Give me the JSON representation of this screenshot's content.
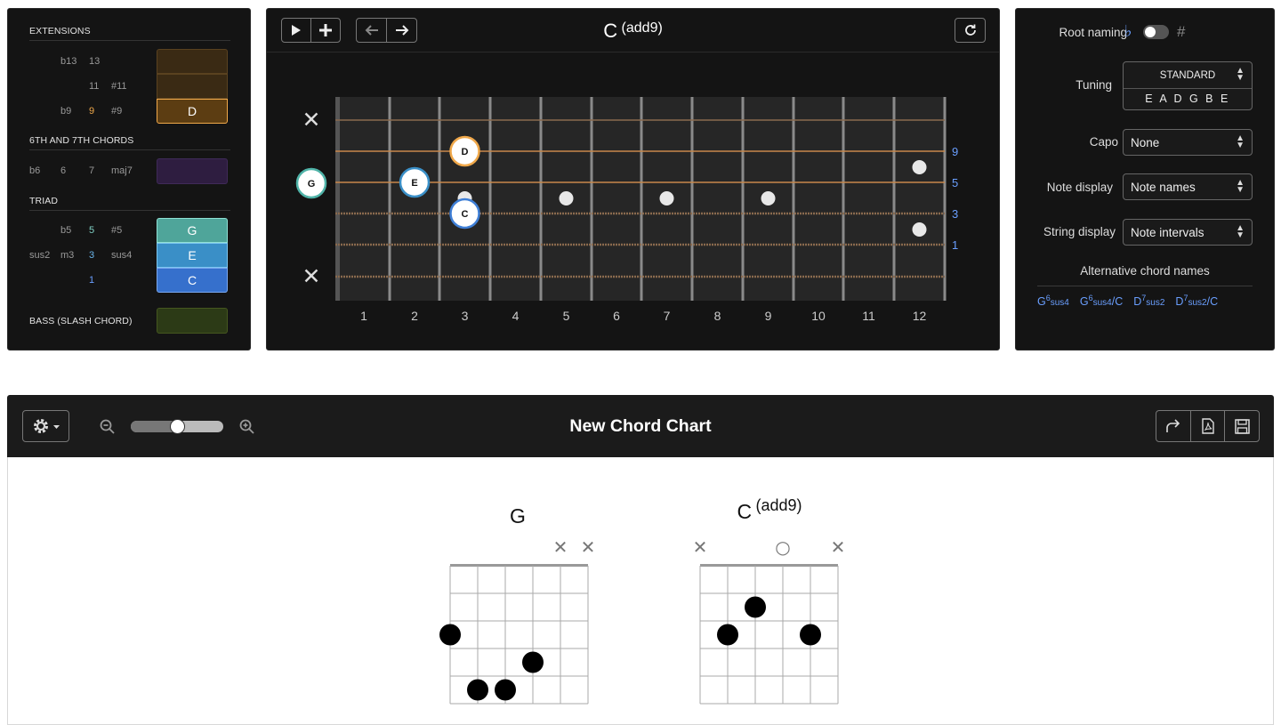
{
  "chord_builder": {
    "extensions": {
      "title": "EXTENSIONS",
      "rows": [
        [
          "b13",
          "13"
        ],
        [
          "11",
          "#11"
        ],
        [
          "b9",
          "9",
          "#9"
        ]
      ],
      "selected": [
        "",
        "",
        "D"
      ]
    },
    "sixth_seventh": {
      "title": "6TH AND 7TH CHORDS",
      "intervals": [
        "b6",
        "6",
        "7",
        "maj7"
      ],
      "selected": ""
    },
    "triad": {
      "title": "TRIAD",
      "rows": [
        [
          "b5",
          "5",
          "#5"
        ],
        [
          "sus2",
          "m3",
          "3",
          "sus4"
        ],
        [
          "1"
        ]
      ],
      "selected": [
        "G",
        "E",
        "C"
      ]
    },
    "bass": {
      "title": "BASS (SLASH CHORD)",
      "selected": ""
    }
  },
  "fretboard": {
    "chord_root": "C",
    "chord_suffix": "(add9)",
    "string_markers": [
      "✕",
      "G",
      "✕"
    ],
    "notes": [
      {
        "label": "D",
        "string": 3,
        "fret": 3,
        "kind": "ext"
      },
      {
        "label": "E",
        "string": 4,
        "fret": 2,
        "kind": "third"
      },
      {
        "label": "C",
        "string": 5,
        "fret": 3,
        "kind": "root"
      }
    ],
    "open_note": {
      "label": "G",
      "string": 2
    },
    "muted_strings": [
      1,
      6
    ],
    "interval_labels": [
      "9",
      "5",
      "3",
      "1"
    ],
    "fret_numbers": [
      "1",
      "2",
      "3",
      "4",
      "5",
      "6",
      "7",
      "8",
      "9",
      "10",
      "11",
      "12"
    ],
    "inlays": [
      3,
      5,
      7,
      9,
      12
    ]
  },
  "settings": {
    "root_naming_label": "Root naming",
    "flat_symbol": "♭",
    "sharp_symbol": "#",
    "tuning_label": "Tuning",
    "tuning_name": "STANDARD",
    "tuning_notes": "E A D G B E",
    "capo_label": "Capo",
    "capo_value": "None",
    "note_display_label": "Note display",
    "note_display_value": "Note names",
    "string_display_label": "String display",
    "string_display_value": "Note intervals",
    "alt_names_label": "Alternative chord names",
    "alt_names": [
      {
        "root": "G",
        "sup": "6",
        "sub": "sus4",
        "bass": ""
      },
      {
        "root": "G",
        "sup": "6",
        "sub": "sus4",
        "bass": "/C"
      },
      {
        "root": "D",
        "sup": "7",
        "sub": "sus2",
        "bass": ""
      },
      {
        "root": "D",
        "sup": "7",
        "sub": "sus2",
        "bass": "/C"
      }
    ]
  },
  "chart": {
    "title": "New Chord Chart",
    "zoom_level": 0.5,
    "diagrams": [
      {
        "name": "G",
        "suffix": "",
        "top_markers": [
          "",
          "",
          "",
          "",
          "✕",
          "✕"
        ],
        "dots": [
          {
            "s": 0,
            "f": 3
          },
          {
            "s": 1,
            "f": 5
          },
          {
            "s": 2,
            "f": 5
          },
          {
            "s": 3,
            "f": 4
          }
        ]
      },
      {
        "name": "C",
        "suffix": "(add9)",
        "top_markers": [
          "✕",
          "",
          "",
          "○",
          "",
          "✕"
        ],
        "dots": [
          {
            "s": 1,
            "f": 3
          },
          {
            "s": 2,
            "f": 2
          },
          {
            "s": 4,
            "f": 3
          }
        ]
      }
    ]
  },
  "colors": {
    "extension_accent": "#f0a84a",
    "seventh_accent": "#6b3fa0",
    "triad_fifth": "#4fa59a",
    "triad_third": "#3a8fc7",
    "triad_root": "#3f7fd6",
    "bass_accent": "#5a7a2a",
    "interval_blue": "#6a9fff"
  }
}
